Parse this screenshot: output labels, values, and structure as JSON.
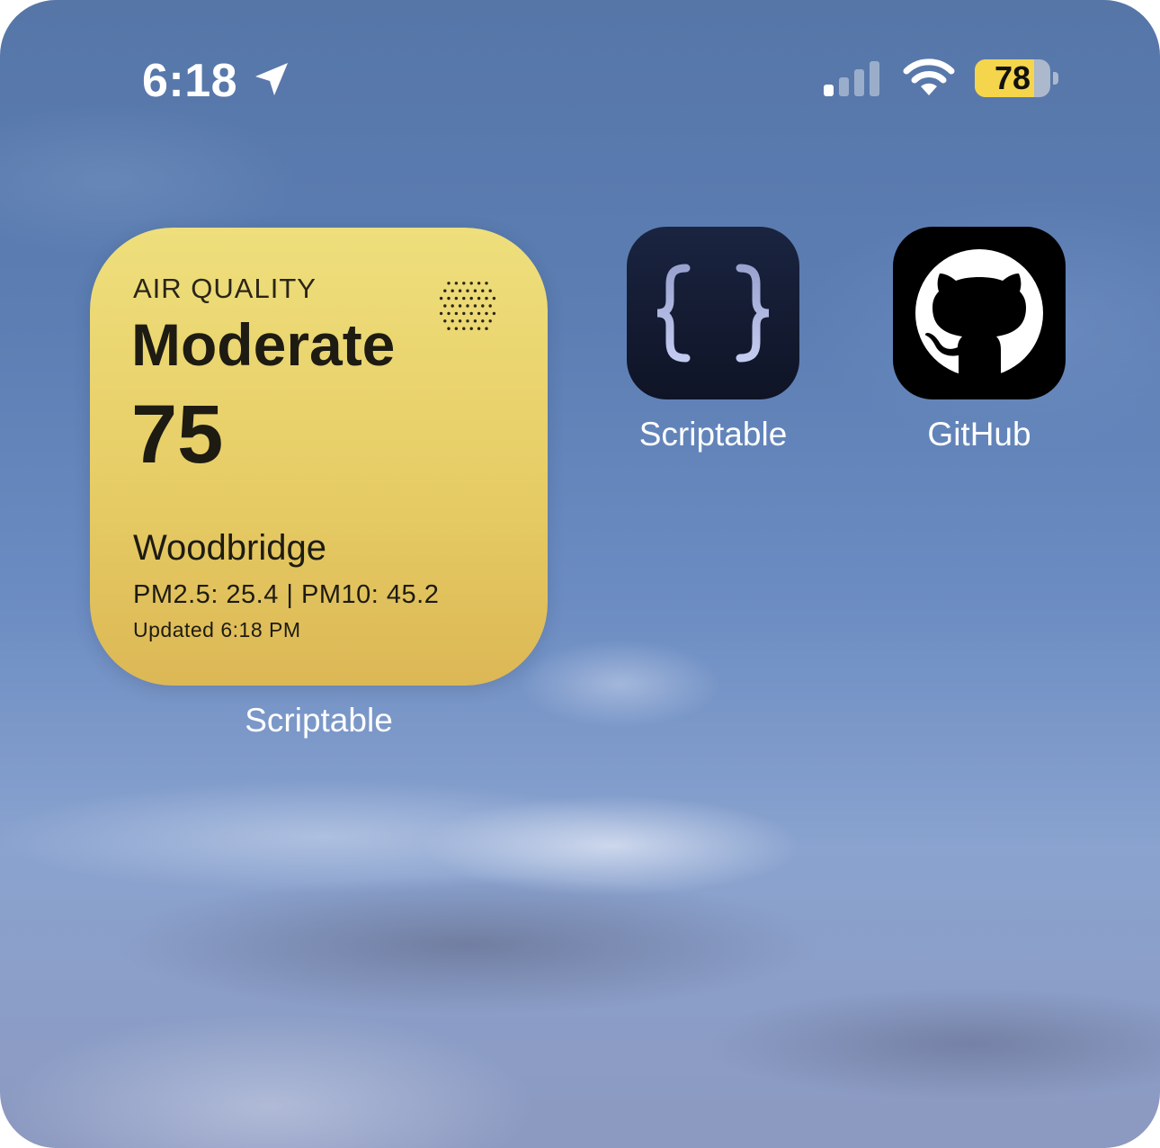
{
  "status_bar": {
    "time": "6:18",
    "battery_level": "78",
    "battery_fraction": 0.78,
    "icons": [
      "location-arrow-icon",
      "cellular-signal-icon",
      "wifi-icon",
      "battery-icon"
    ]
  },
  "widget": {
    "label": "AIR QUALITY",
    "level": "Moderate",
    "aqi": "75",
    "location": "Woodbridge",
    "pm_readings": "PM2.5: 25.4 | PM10: 45.2",
    "updated": "Updated 6:18 PM",
    "caption": "Scriptable",
    "background_color": "#e7cd66"
  },
  "apps": [
    {
      "name": "Scriptable",
      "icon": "scriptable-braces-icon"
    },
    {
      "name": "GitHub",
      "icon": "github-octocat-icon"
    }
  ]
}
